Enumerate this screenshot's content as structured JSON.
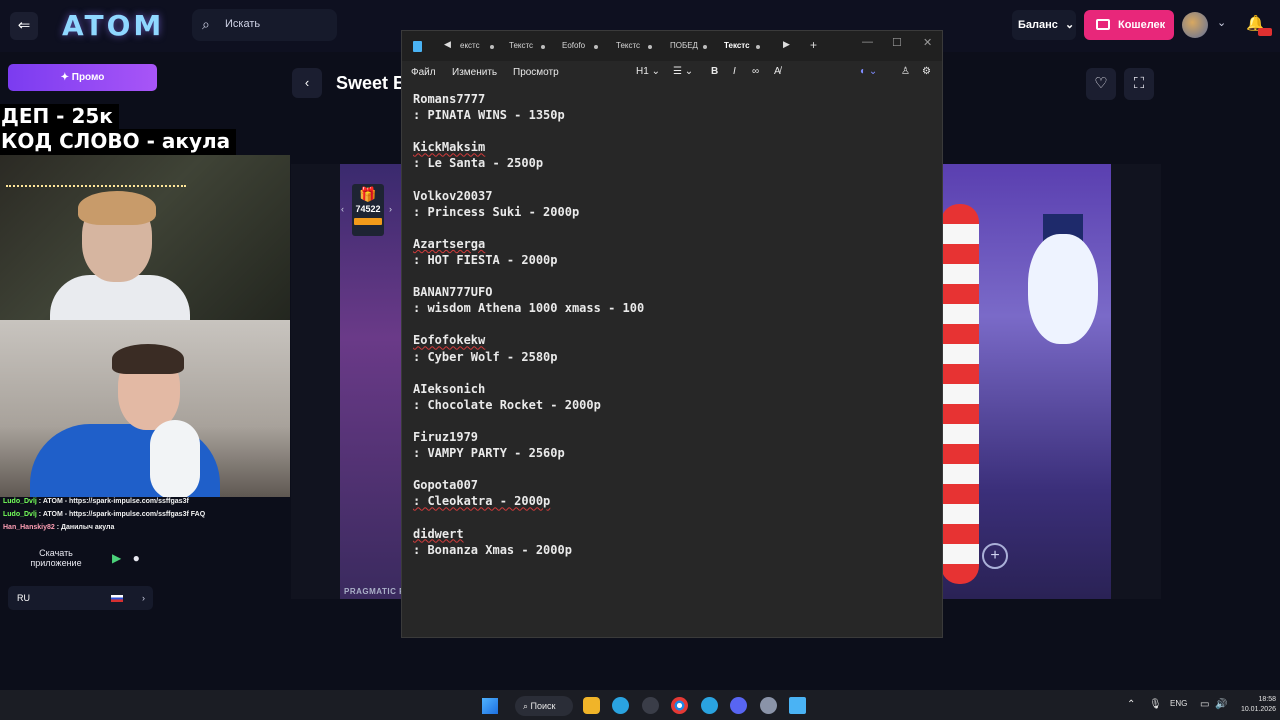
{
  "site": {
    "logo": "ATOM",
    "search_placeholder": "Искать",
    "balance_label": "Баланс",
    "wallet_label": "Кошелек",
    "brand_color": "#e8277a"
  },
  "sidebar": {
    "promo_label": "Промо",
    "overlay_line1": "ДЕП - 25к",
    "overlay_line2": "КОД СЛОВО - акула",
    "chat": [
      {
        "user": "Ludo_Dvlj",
        "text": ": ATOM - https://spark-impulse.com/ssffgas3f"
      },
      {
        "user": "Ludo_Dvlj",
        "text": ": ATOM - https://spark-impulse.com/ssffgas3f"
      },
      {
        "user": "Han_Hanskiy82",
        "text": ": Данилыч акула"
      }
    ],
    "faq_label": "FAQ",
    "download_label": "Скачать приложение",
    "language": "RU"
  },
  "game": {
    "title": "Sweet B",
    "gift_count": "74522",
    "provider": "PRAGMATIC P"
  },
  "notepad": {
    "tabs": [
      {
        "label": "екстс",
        "active": false
      },
      {
        "label": "Текстс",
        "active": false
      },
      {
        "label": "Eofofo",
        "active": false
      },
      {
        "label": "Текстс",
        "active": false
      },
      {
        "label": "ПОБЕД",
        "active": false
      },
      {
        "label": "Текстс",
        "active": true
      }
    ],
    "menu": {
      "file": "Файл",
      "edit": "Изменить",
      "view": "Просмотр"
    },
    "heading_format": "H1",
    "entries": [
      {
        "name": "Romans7777",
        "line": ": PINATA WINS - 1350р"
      },
      {
        "name": "KickMaksim",
        "line": ": Le Santa - 2500р"
      },
      {
        "name": "Volkov20037",
        "line": ": Princess Suki - 2000р"
      },
      {
        "name": "Azartserga",
        "line": ": HOT FIESTA - 2000р"
      },
      {
        "name": "BANAN777UFO",
        "line": ": wisdom Athena 1000 xmass - 100"
      },
      {
        "name": "Eofofokekw",
        "line": ": Cyber Wolf - 2580р"
      },
      {
        "name": "AIeksonich",
        "line": ": Chocolate Rocket - 2000р"
      },
      {
        "name": "Firuz1979",
        "line": ": VAMPY PARTY - 2560р"
      },
      {
        "name": "Gopota007",
        "line": ": Cleokatra - 2000р"
      },
      {
        "name": "didwert",
        "line": ": Bonanza Xmas - 2000р"
      }
    ]
  },
  "taskbar": {
    "search_label": "Поиск",
    "language": "ENG",
    "time": "18:58",
    "date": "10.01.2026"
  }
}
